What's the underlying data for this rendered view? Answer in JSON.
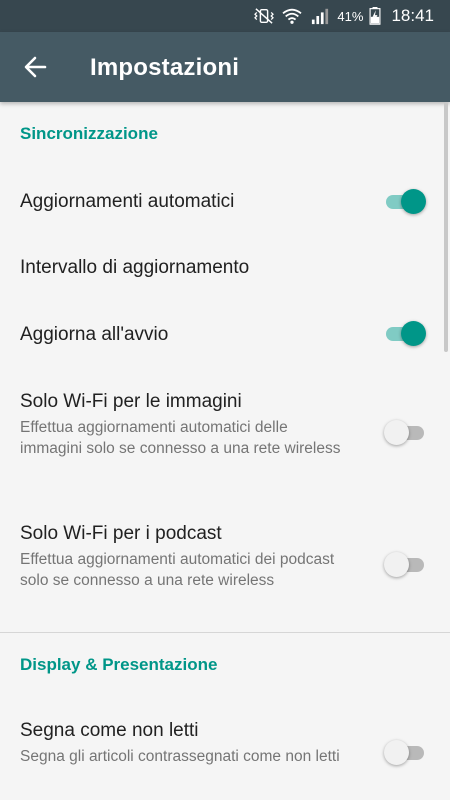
{
  "status_bar": {
    "battery": "41%",
    "time": "18:41",
    "icons": [
      "mute-vibrate-icon",
      "wifi-icon",
      "signal-icon",
      "battery-charging-icon"
    ]
  },
  "app_bar": {
    "back_icon": "arrow-back-icon",
    "title": "Impostazioni"
  },
  "sections": {
    "sync": {
      "header": "Sincronizzazione",
      "items": {
        "auto_updates": {
          "title": "Aggiornamenti automatici",
          "switch": "on"
        },
        "update_interval": {
          "title": "Intervallo di aggiornamento"
        },
        "update_on_start": {
          "title": "Aggiorna all'avvio",
          "switch": "on"
        },
        "wifi_images": {
          "title": "Solo Wi-Fi per le immagini",
          "summary": "Effettua aggiornamenti automatici delle immagini solo se connesso a una rete wireless",
          "switch": "off"
        },
        "wifi_podcasts": {
          "title": "Solo Wi-Fi per i podcast",
          "summary": "Effettua aggiornamenti automatici dei podcast solo se connesso a una rete wireless",
          "switch": "off"
        }
      }
    },
    "display": {
      "header": "Display & Presentazione",
      "items": {
        "mark_unread": {
          "title": "Segna come non letti",
          "summary": "Segna gli articoli contrassegnati come non letti",
          "switch": "off"
        }
      }
    }
  },
  "colors": {
    "status_bar": "#37474f",
    "app_bar": "#455a64",
    "accent": "#009688",
    "background": "#f5f5f5"
  }
}
